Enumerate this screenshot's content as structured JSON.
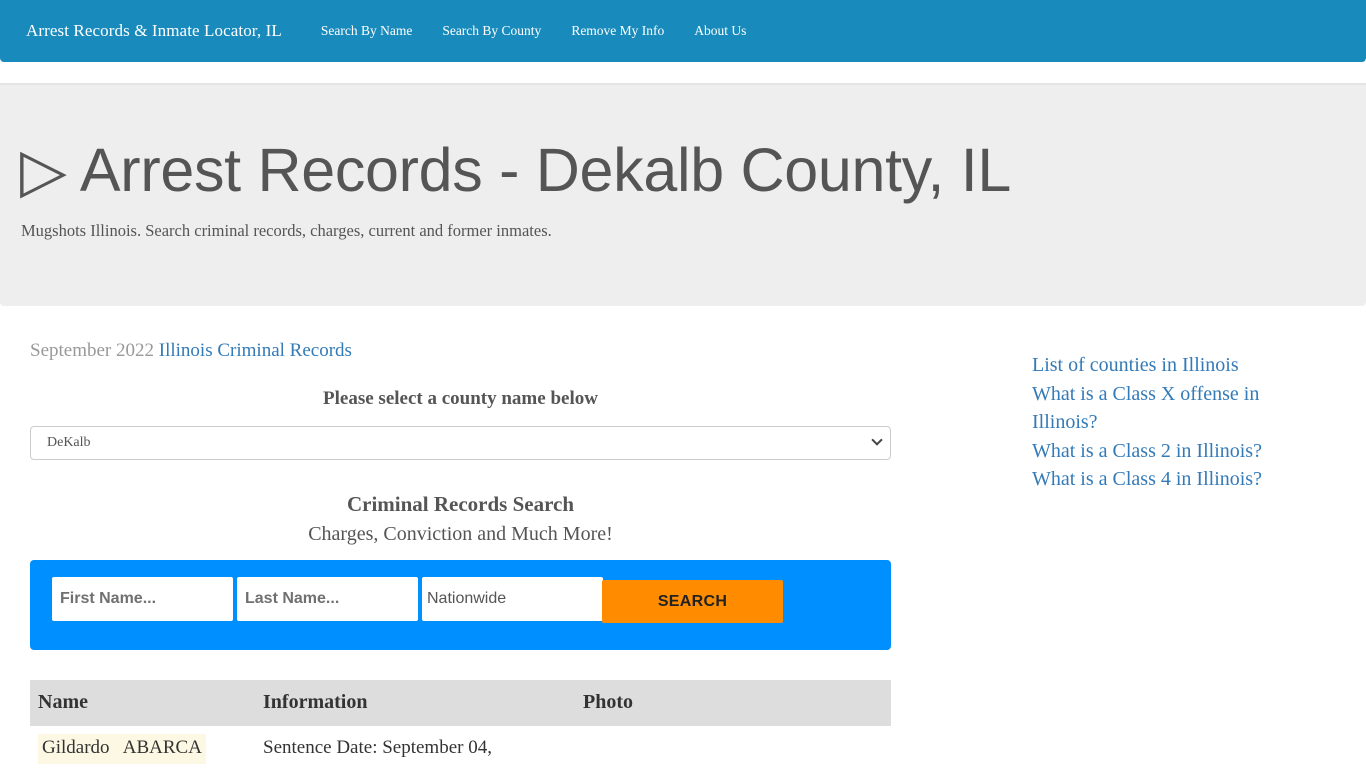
{
  "navbar": {
    "brand": "Arrest Records & Inmate Locator, IL",
    "links": [
      "Search By Name",
      "Search By County",
      "Remove My Info",
      "About Us"
    ],
    "background_color": "#188bbc"
  },
  "header": {
    "title_icon": "▷",
    "title": "Arrest Records - Dekalb County, IL",
    "subtitle": "Mugshots Illinois. Search criminal records, charges, current and former inmates."
  },
  "main": {
    "date_prefix": "September 2022",
    "date_link": "Illinois Criminal Records",
    "select_label": "Please select a county name below",
    "county_select_value": "DeKalb",
    "search_title": "Criminal Records Search",
    "search_subtitle": "Charges, Conviction and Much More!",
    "search_form": {
      "first_name_placeholder": "First Name...",
      "last_name_placeholder": "Last Name...",
      "location_value": "Nationwide",
      "search_button": "SEARCH",
      "background_color": "#008ffe",
      "button_color": "#ff8c00"
    },
    "table": {
      "headers": [
        "Name",
        "Information",
        "Photo"
      ],
      "rows": [
        {
          "name": "Gildardo   ABARCA",
          "information": "Sentence Date: September 04,"
        }
      ]
    }
  },
  "sidebar": {
    "links": [
      "List of counties in Illinois",
      "What is a Class X offense in Illinois?",
      "What is a Class 2 in Illinois?",
      "What is a Class 4 in Illinois?"
    ]
  }
}
